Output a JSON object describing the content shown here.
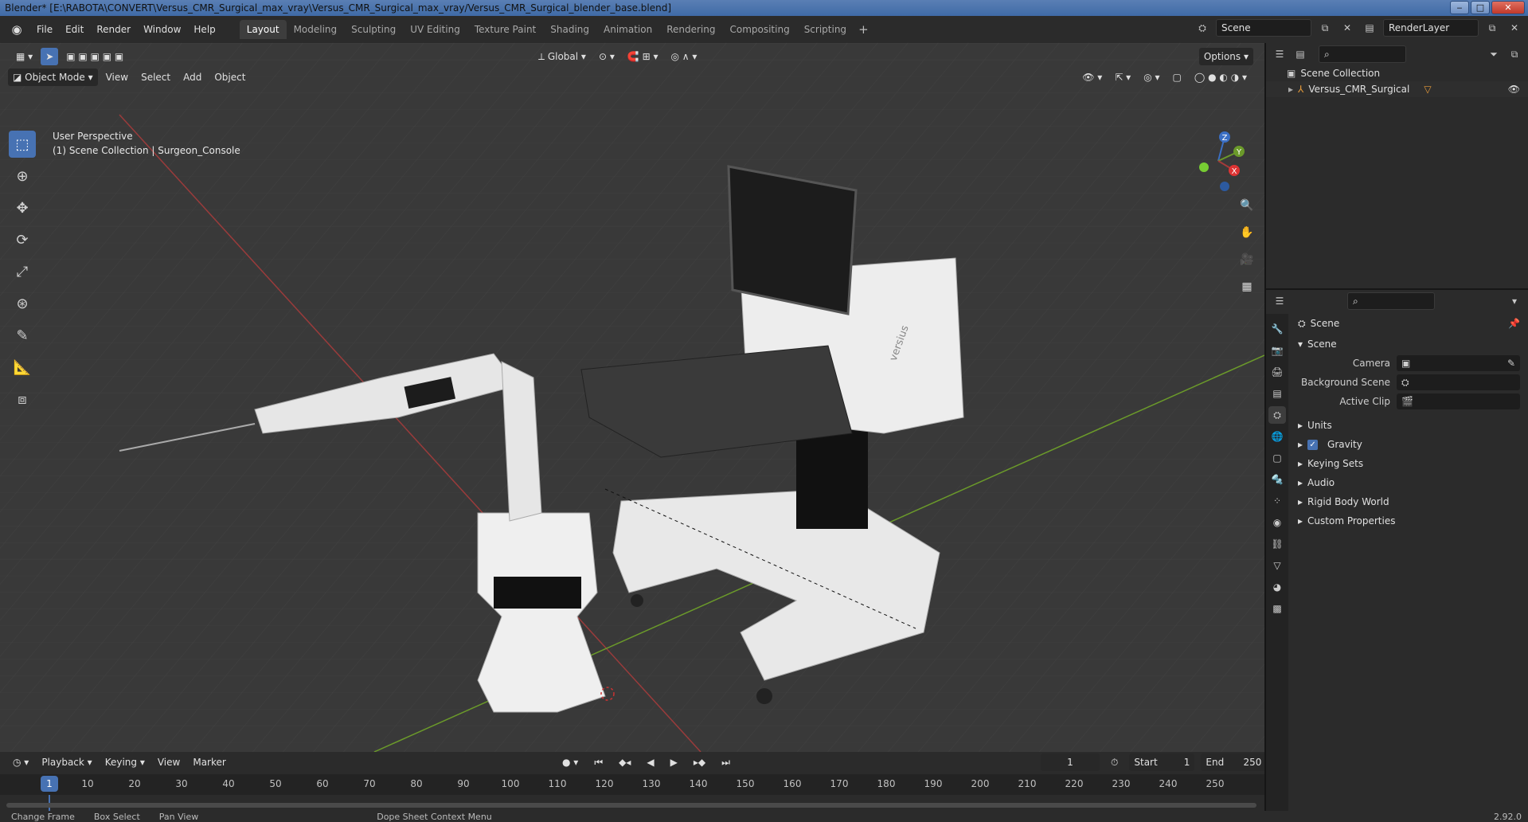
{
  "window": {
    "title": "Blender* [E:\\RABOTA\\CONVERT\\Versus_CMR_Surgical_max_vray\\Versus_CMR_Surgical_max_vray/Versus_CMR_Surgical_blender_base.blend]",
    "min": "‒",
    "max": "□",
    "close": "✕"
  },
  "menu": {
    "items": [
      "File",
      "Edit",
      "Render",
      "Window",
      "Help"
    ],
    "workspaces": [
      "Layout",
      "Modeling",
      "Sculpting",
      "UV Editing",
      "Texture Paint",
      "Shading",
      "Animation",
      "Rendering",
      "Compositing",
      "Scripting"
    ],
    "add_tab": "+",
    "scene": "Scene",
    "render_layer": "RenderLayer"
  },
  "viewport": {
    "mode": "Object Mode",
    "menus": [
      "View",
      "Select",
      "Add",
      "Object"
    ],
    "transform_orientation": "Global",
    "options": "Options",
    "perspective": "User Perspective",
    "collection_info": "(1) Scene Collection | Surgeon_Console",
    "gizmo": {
      "z": "Z",
      "y": "Y",
      "x": "X"
    },
    "screen_text": "versius"
  },
  "timeline": {
    "menus": [
      "Playback",
      "Keying",
      "View",
      "Marker"
    ],
    "current_frame": "1",
    "start_label": "Start",
    "start": "1",
    "end_label": "End",
    "end": "250",
    "ticks": [
      "10",
      "20",
      "30",
      "40",
      "50",
      "60",
      "70",
      "80",
      "90",
      "100",
      "110",
      "120",
      "130",
      "140",
      "150",
      "160",
      "170",
      "180",
      "190",
      "200",
      "210",
      "220",
      "230",
      "240",
      "250"
    ],
    "playhead": "1"
  },
  "statusbar": {
    "items": [
      "Change Frame",
      "Box Select",
      "Pan View",
      "Dope Sheet Context Menu"
    ],
    "version": "2.92.0"
  },
  "outliner": {
    "root": "Scene Collection",
    "items": [
      {
        "label": "Versus_CMR_Surgical"
      }
    ]
  },
  "properties": {
    "context": "Scene",
    "panel": "Scene",
    "fields": [
      {
        "label": "Camera",
        "value": ""
      },
      {
        "label": "Background Scene",
        "value": ""
      },
      {
        "label": "Active Clip",
        "value": ""
      }
    ],
    "subpanels": [
      "Units",
      "Gravity",
      "Keying Sets",
      "Audio",
      "Rigid Body World",
      "Custom Properties"
    ]
  },
  "colors": {
    "accent": "#4772b3",
    "x_axis": "#a33a3a",
    "y_axis": "#6b9a2a",
    "z_axis": "#3b6fc4"
  }
}
